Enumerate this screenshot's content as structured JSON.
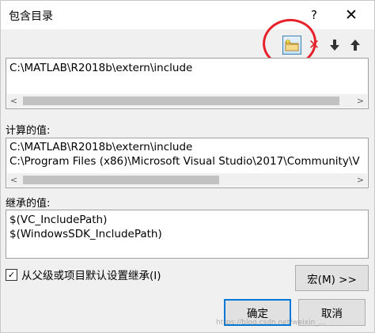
{
  "dialog": {
    "title": "包含目录",
    "help_label": "?",
    "close_label": "✕"
  },
  "toolbar": {
    "delete_glyph": "✕",
    "down_glyph": "🡇",
    "up_glyph": "🡅"
  },
  "include_dirs": {
    "rows": [
      "C:\\MATLAB\\R2018b\\extern\\include"
    ]
  },
  "evaluated": {
    "label": "计算的值:",
    "rows": [
      "C:\\MATLAB\\R2018b\\extern\\include",
      "C:\\Program Files (x86)\\Microsoft Visual Studio\\2017\\Community\\V"
    ]
  },
  "inherited": {
    "label": "继承的值:",
    "rows": [
      "$(VC_IncludePath)",
      "$(WindowsSDK_IncludePath)"
    ]
  },
  "inherit_checkbox": {
    "label": "从父级或项目默认设置继承(I)",
    "checked": true,
    "check_glyph": "✓"
  },
  "buttons": {
    "macro": "宏(M) >>",
    "ok": "确定",
    "cancel": "取消"
  },
  "scroll": {
    "left_glyph": "<",
    "right_glyph": ">"
  },
  "watermark": "https://blog.csdn.net/weixin_..."
}
